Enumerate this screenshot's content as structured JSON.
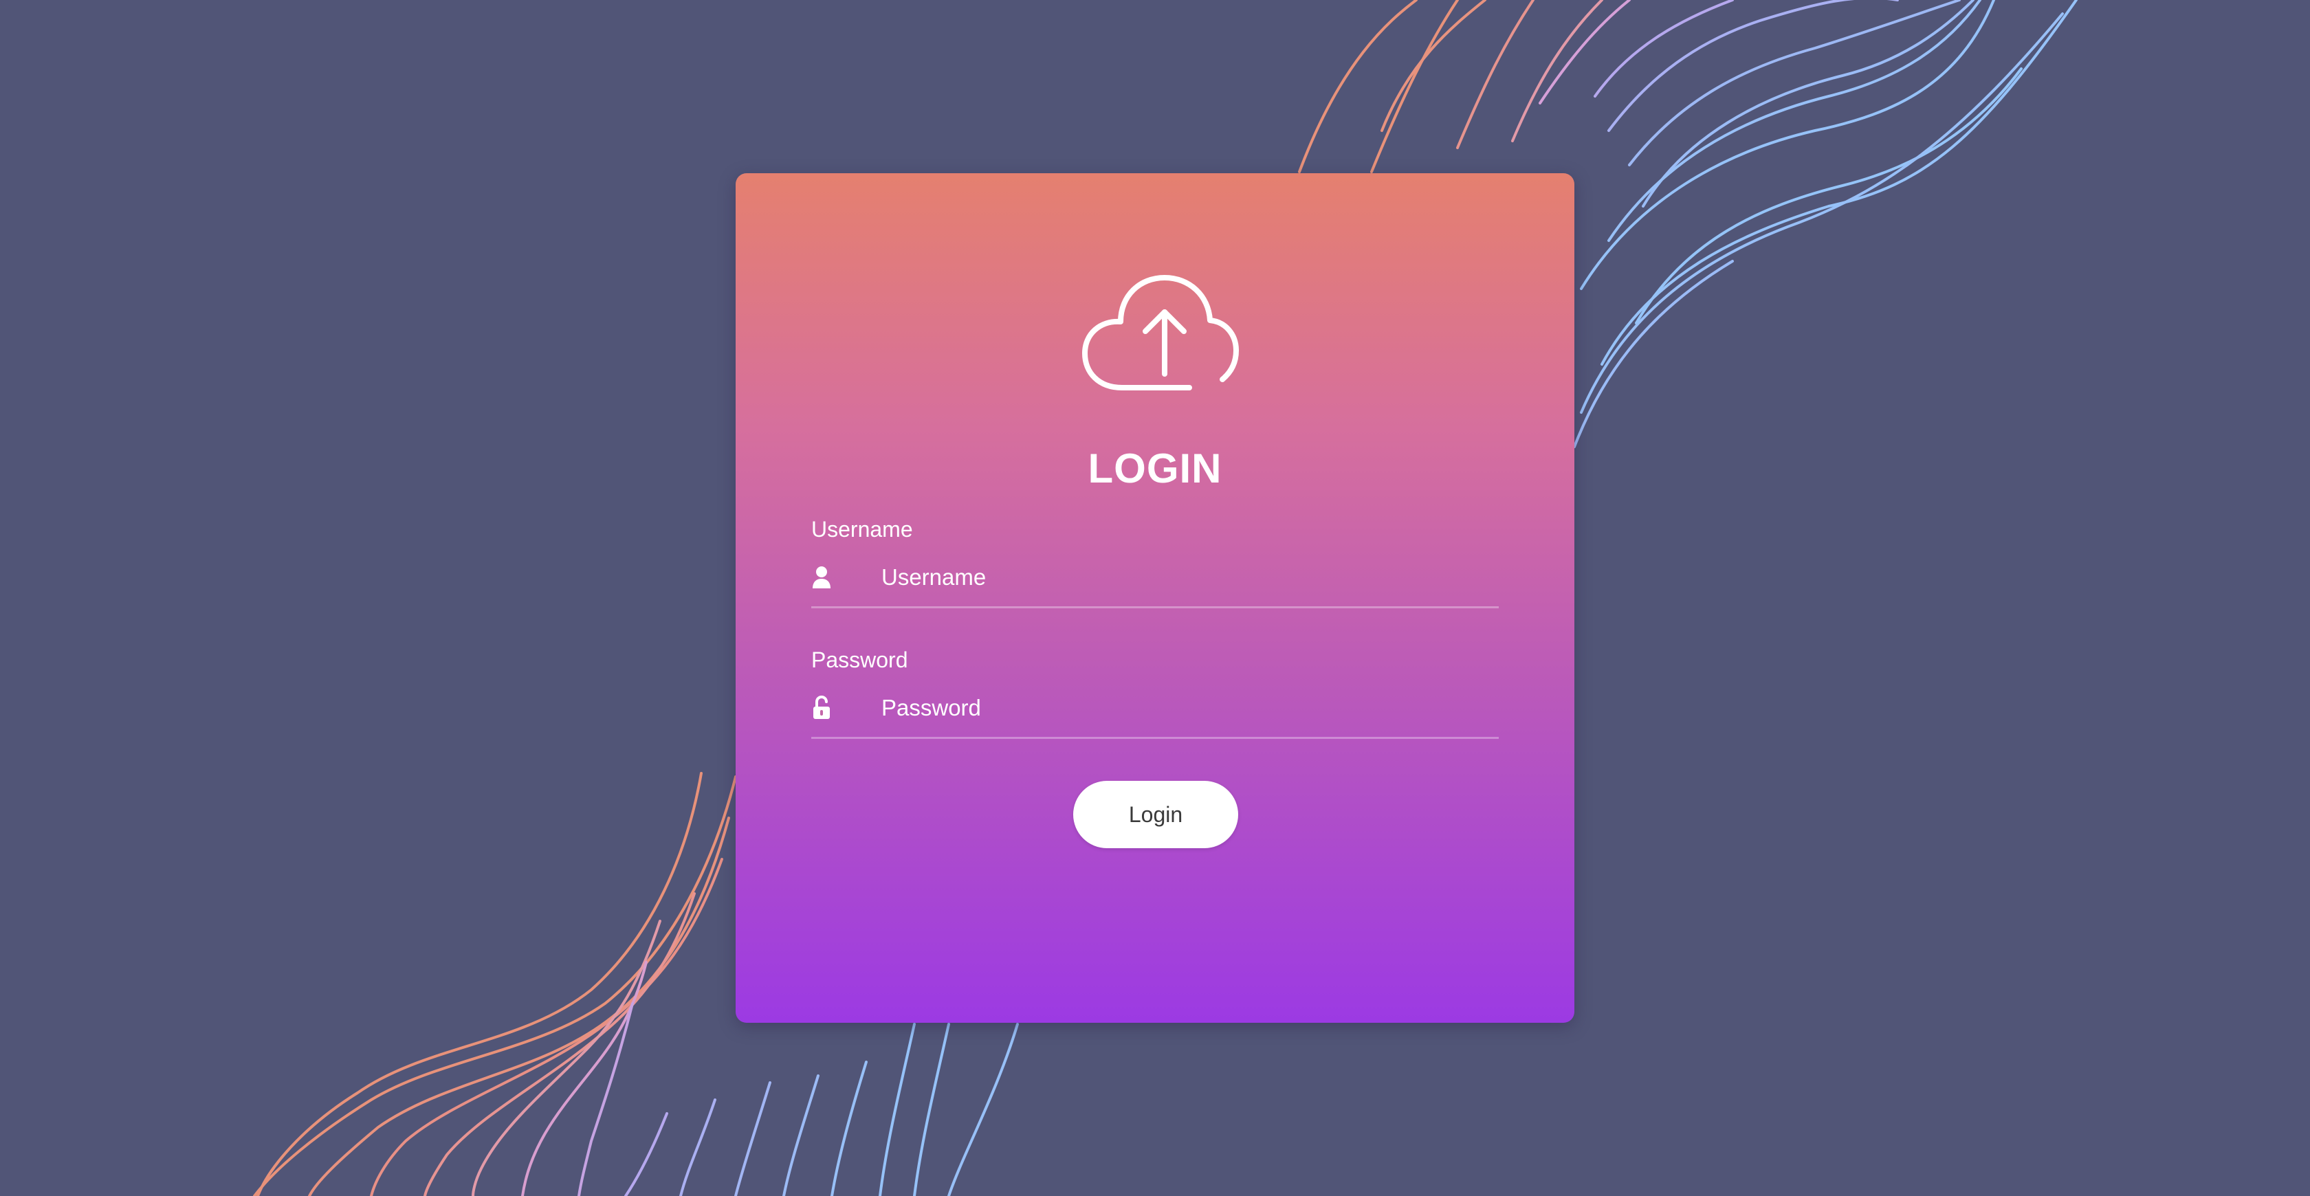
{
  "colors": {
    "background": "#515577",
    "card_top": "#e5806f",
    "card_bottom": "#9c3ae3",
    "text": "#ffffff",
    "button_bg": "#ffffff",
    "button_text": "#3a3a3a"
  },
  "login_card": {
    "icon": "cloud-upload-icon",
    "title": "LOGIN",
    "username": {
      "label": "Username",
      "placeholder": "Username",
      "value": "",
      "icon": "user-icon"
    },
    "password": {
      "label": "Password",
      "placeholder": "Password",
      "value": "",
      "icon": "unlock-icon"
    },
    "submit_label": "Login"
  }
}
